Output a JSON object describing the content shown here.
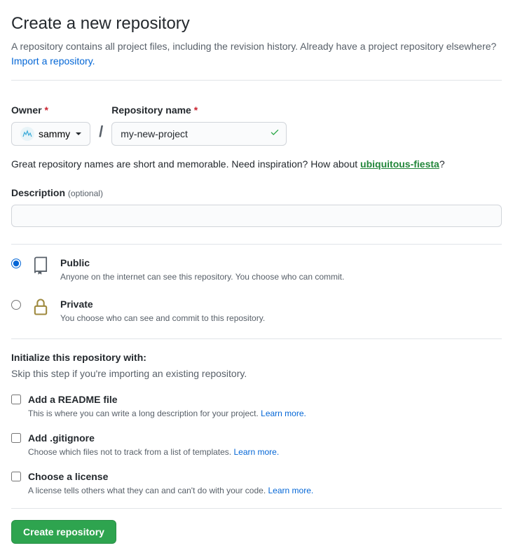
{
  "header": {
    "title": "Create a new repository",
    "subtitle_prefix": "A repository contains all project files, including the revision history. Already have a project repository elsewhere? ",
    "import_link": "Import a repository."
  },
  "owner": {
    "label": "Owner",
    "value": "sammy"
  },
  "repo": {
    "label": "Repository name",
    "value": "my-new-project"
  },
  "hint": {
    "prefix": "Great repository names are short and memorable. Need inspiration? How about ",
    "suggestion": "ubiquitous-fiesta",
    "suffix": "?"
  },
  "description": {
    "label": "Description",
    "optional": "(optional)",
    "value": ""
  },
  "visibility": {
    "public": {
      "title": "Public",
      "desc": "Anyone on the internet can see this repository. You choose who can commit.",
      "checked": true
    },
    "private": {
      "title": "Private",
      "desc": "You choose who can see and commit to this repository.",
      "checked": false
    }
  },
  "initialize": {
    "title": "Initialize this repository with:",
    "subtitle": "Skip this step if you're importing an existing repository.",
    "readme": {
      "title": "Add a README file",
      "desc": "This is where you can write a long description for your project. ",
      "link": "Learn more."
    },
    "gitignore": {
      "title": "Add .gitignore",
      "desc": "Choose which files not to track from a list of templates. ",
      "link": "Learn more."
    },
    "license": {
      "title": "Choose a license",
      "desc": "A license tells others what they can and can't do with your code. ",
      "link": "Learn more."
    }
  },
  "submit": {
    "label": "Create repository"
  }
}
